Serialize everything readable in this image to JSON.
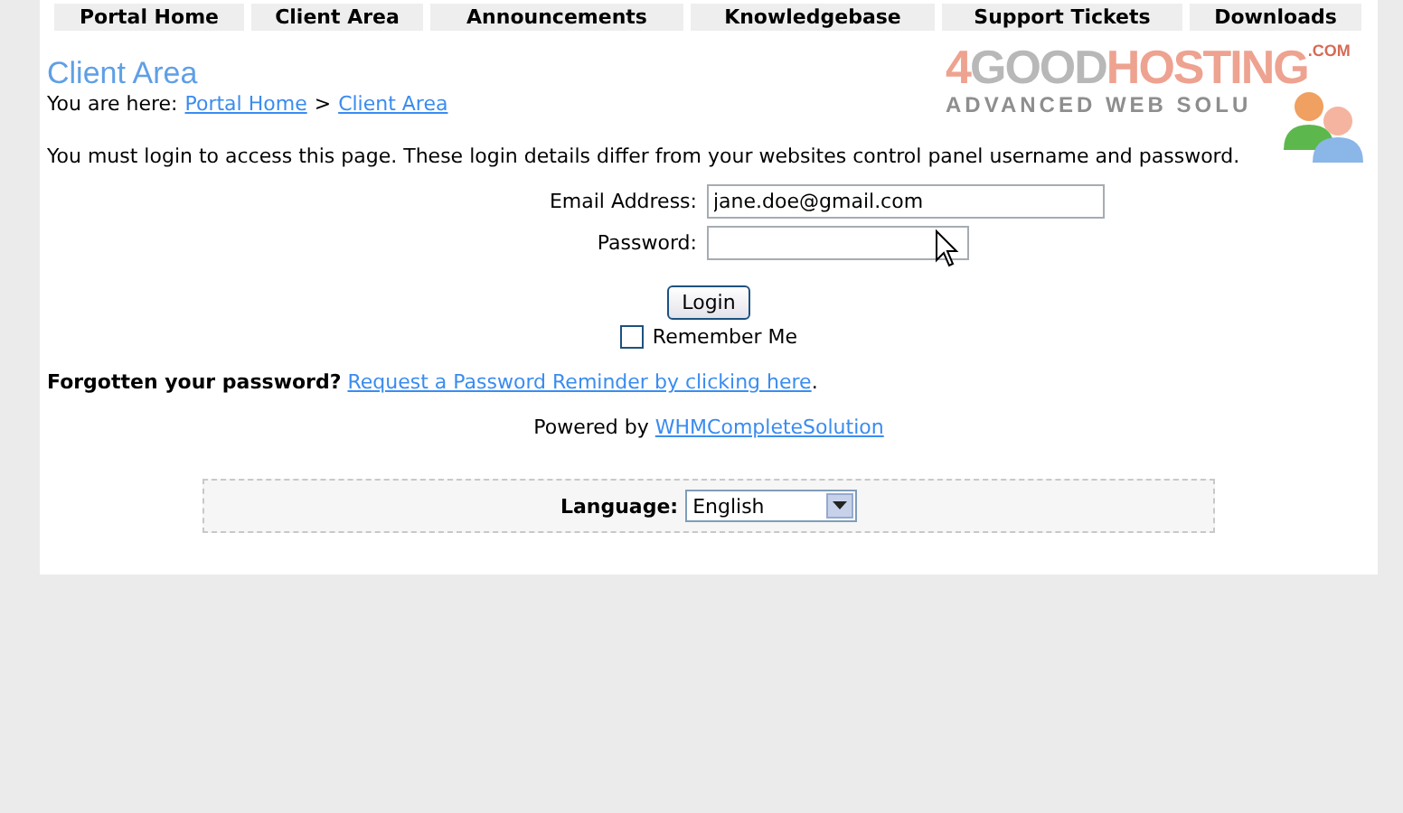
{
  "nav": [
    {
      "label": "Portal Home"
    },
    {
      "label": "Client Area"
    },
    {
      "label": "Announcements"
    },
    {
      "label": "Knowledgebase"
    },
    {
      "label": "Support Tickets"
    },
    {
      "label": "Downloads"
    }
  ],
  "logo": {
    "number": "4",
    "word_1": "GOOD",
    "word_2": "HOSTING",
    "suffix": ".COM",
    "tagline": "ADVANCED WEB SOLU"
  },
  "page_title": "Client Area",
  "breadcrumb": {
    "prefix": "You are here:",
    "links": [
      "Portal Home",
      "Client Area"
    ],
    "separator": ">"
  },
  "intro": "You must login to access this page. These login details differ from your websites control panel username and password.",
  "form": {
    "email_label": "Email Address:",
    "email_value": "jane.doe@gmail.com",
    "password_label": "Password:",
    "login_button": "Login",
    "remember": {
      "label": "Remember Me",
      "checked": false
    }
  },
  "forgot": {
    "question": "Forgotten your password?",
    "link": "Request a Password Reminder by clicking here",
    "end": "."
  },
  "powered": {
    "prefix": "Powered by",
    "link": "WHMCompleteSolution"
  },
  "language": {
    "label": "Language:",
    "value": "English"
  }
}
